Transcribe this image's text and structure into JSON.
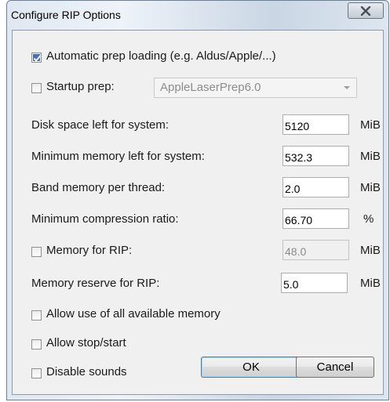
{
  "window": {
    "title": "Configure RIP Options"
  },
  "options": {
    "auto_prep": {
      "label": "Automatic prep loading (e.g. Aldus/Apple/...)",
      "checked": true
    },
    "startup_prep": {
      "label": "Startup prep:",
      "checked": false,
      "value": "AppleLaserPrep6.0"
    },
    "disk_space": {
      "label": "Disk space left for system:",
      "value": "5120",
      "unit": "MiB"
    },
    "min_memory": {
      "label": "Minimum memory left for system:",
      "value": "532.3",
      "unit": "MiB"
    },
    "band_memory": {
      "label": "Band memory per thread:",
      "value": "2.0",
      "unit": "MiB"
    },
    "min_compression": {
      "label": "Minimum compression ratio:",
      "value": "66.70",
      "unit": "%"
    },
    "memory_for_rip": {
      "label": "Memory for RIP:",
      "checked": false,
      "value": "48.0",
      "unit": "MiB"
    },
    "memory_reserve": {
      "label": "Memory reserve for RIP:",
      "value": "5.0",
      "unit": "MiB"
    },
    "allow_all_memory": {
      "label": "Allow use of all available memory",
      "checked": false
    },
    "allow_stop_start": {
      "label": "Allow stop/start",
      "checked": false
    },
    "disable_sounds": {
      "label": "Disable sounds",
      "checked": false
    }
  },
  "buttons": {
    "ok": "OK",
    "cancel": "Cancel"
  },
  "icons": {
    "close": "close-x-icon",
    "check": "checkmark-icon",
    "dropdown": "chevron-down-icon"
  }
}
